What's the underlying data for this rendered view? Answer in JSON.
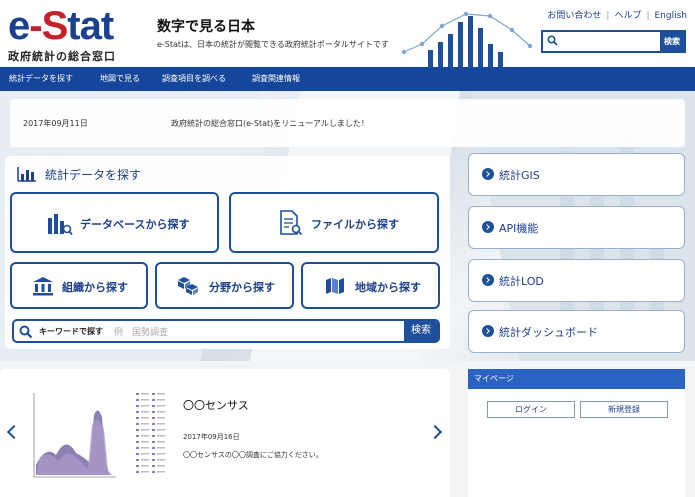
{
  "header": {
    "logo_text": "e-Stat",
    "logo_subtitle": "政府統計の総合窓口",
    "tagline_title": "数字で見る日本",
    "tagline_sub": "e-Statは、日本の統計が閲覧できる政府統計ポータルサイトです",
    "util_links": [
      "お問い合わせ",
      "ヘルプ",
      "English"
    ],
    "search": {
      "placeholder": "",
      "button": "検索"
    }
  },
  "nav": {
    "items": [
      "統計データを探す",
      "地図で見る",
      "調査項目を調べる",
      "調査関連情報"
    ]
  },
  "news": {
    "date": "2017年09月11日",
    "text": "政府統計の総合窓口(e-Stat)をリニューアルしました！"
  },
  "main": {
    "title": "統計データを探す",
    "buttons": {
      "database": "データベースから探す",
      "file": "ファイルから探す",
      "org": "組織から探す",
      "field": "分野から探す",
      "region": "地域から探す"
    },
    "keyword": {
      "label": "キーワードで探す",
      "placeholder": "例　国勢調査",
      "button": "検索"
    }
  },
  "side": {
    "items": [
      "統計GIS",
      "API機能",
      "統計LOD",
      "統計ダッシュボード"
    ]
  },
  "carousel": {
    "title": "〇〇センサス",
    "date": "2017年09月16日",
    "desc": "〇〇センサスの〇〇調査にご協力ください。"
  },
  "mypage": {
    "title": "マイページ",
    "login": "ログイン",
    "register": "新規登録"
  },
  "colors": {
    "brand_blue": "#1d3f8f",
    "nav_blue": "#16469a",
    "logo_red": "#c5212a",
    "mypage_blue": "#2a63c0"
  },
  "icons": {
    "header_search": "search-icon",
    "title": "bar-chart-icon",
    "database": "database-search-icon",
    "file": "file-search-icon",
    "org": "building-icon",
    "field": "boxes-icon",
    "region": "map-icon",
    "keyword": "search-icon",
    "side": "chevron-right-icon",
    "carousel_prev": "chevron-left-icon",
    "carousel_next": "chevron-right-icon"
  }
}
